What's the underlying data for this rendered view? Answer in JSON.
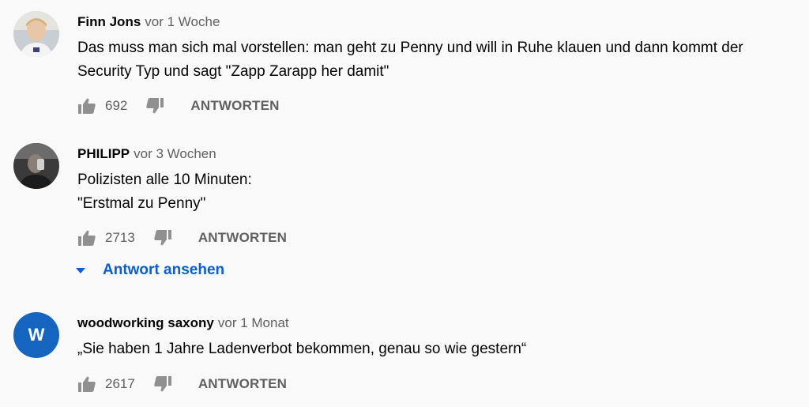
{
  "comments": [
    {
      "author": "Finn Jons",
      "time": "vor 1 Woche",
      "lines": [
        "Das muss man sich mal vorstellen: man geht zu Penny und will in Ruhe klauen und dann kommt der",
        "Security Typ und sagt \"Zapp Zarapp her damit\""
      ],
      "likes": "692",
      "reply_label": "ANTWORTEN"
    },
    {
      "author": "PHILIPP",
      "time": "vor 3 Wochen",
      "lines": [
        "Polizisten alle 10 Minuten:",
        "\"Erstmal zu Penny\""
      ],
      "likes": "2713",
      "reply_label": "ANTWORTEN",
      "view_replies_label": "Antwort ansehen"
    },
    {
      "author": "woodworking saxony",
      "time": "vor 1 Monat",
      "avatar_letter": "W",
      "lines": [
        "„Sie haben 1 Jahre Ladenverbot bekommen, genau so wie gestern“"
      ],
      "likes": "2617",
      "reply_label": "ANTWORTEN"
    }
  ],
  "icons": {
    "like": "thumb-up-icon",
    "dislike": "thumb-down-icon",
    "expand": "caret-down-icon"
  },
  "colors": {
    "background": "#f9f9f9",
    "text": "#030303",
    "secondary": "#606060",
    "link": "#065fd4",
    "avatar_w": "#1565c0"
  }
}
